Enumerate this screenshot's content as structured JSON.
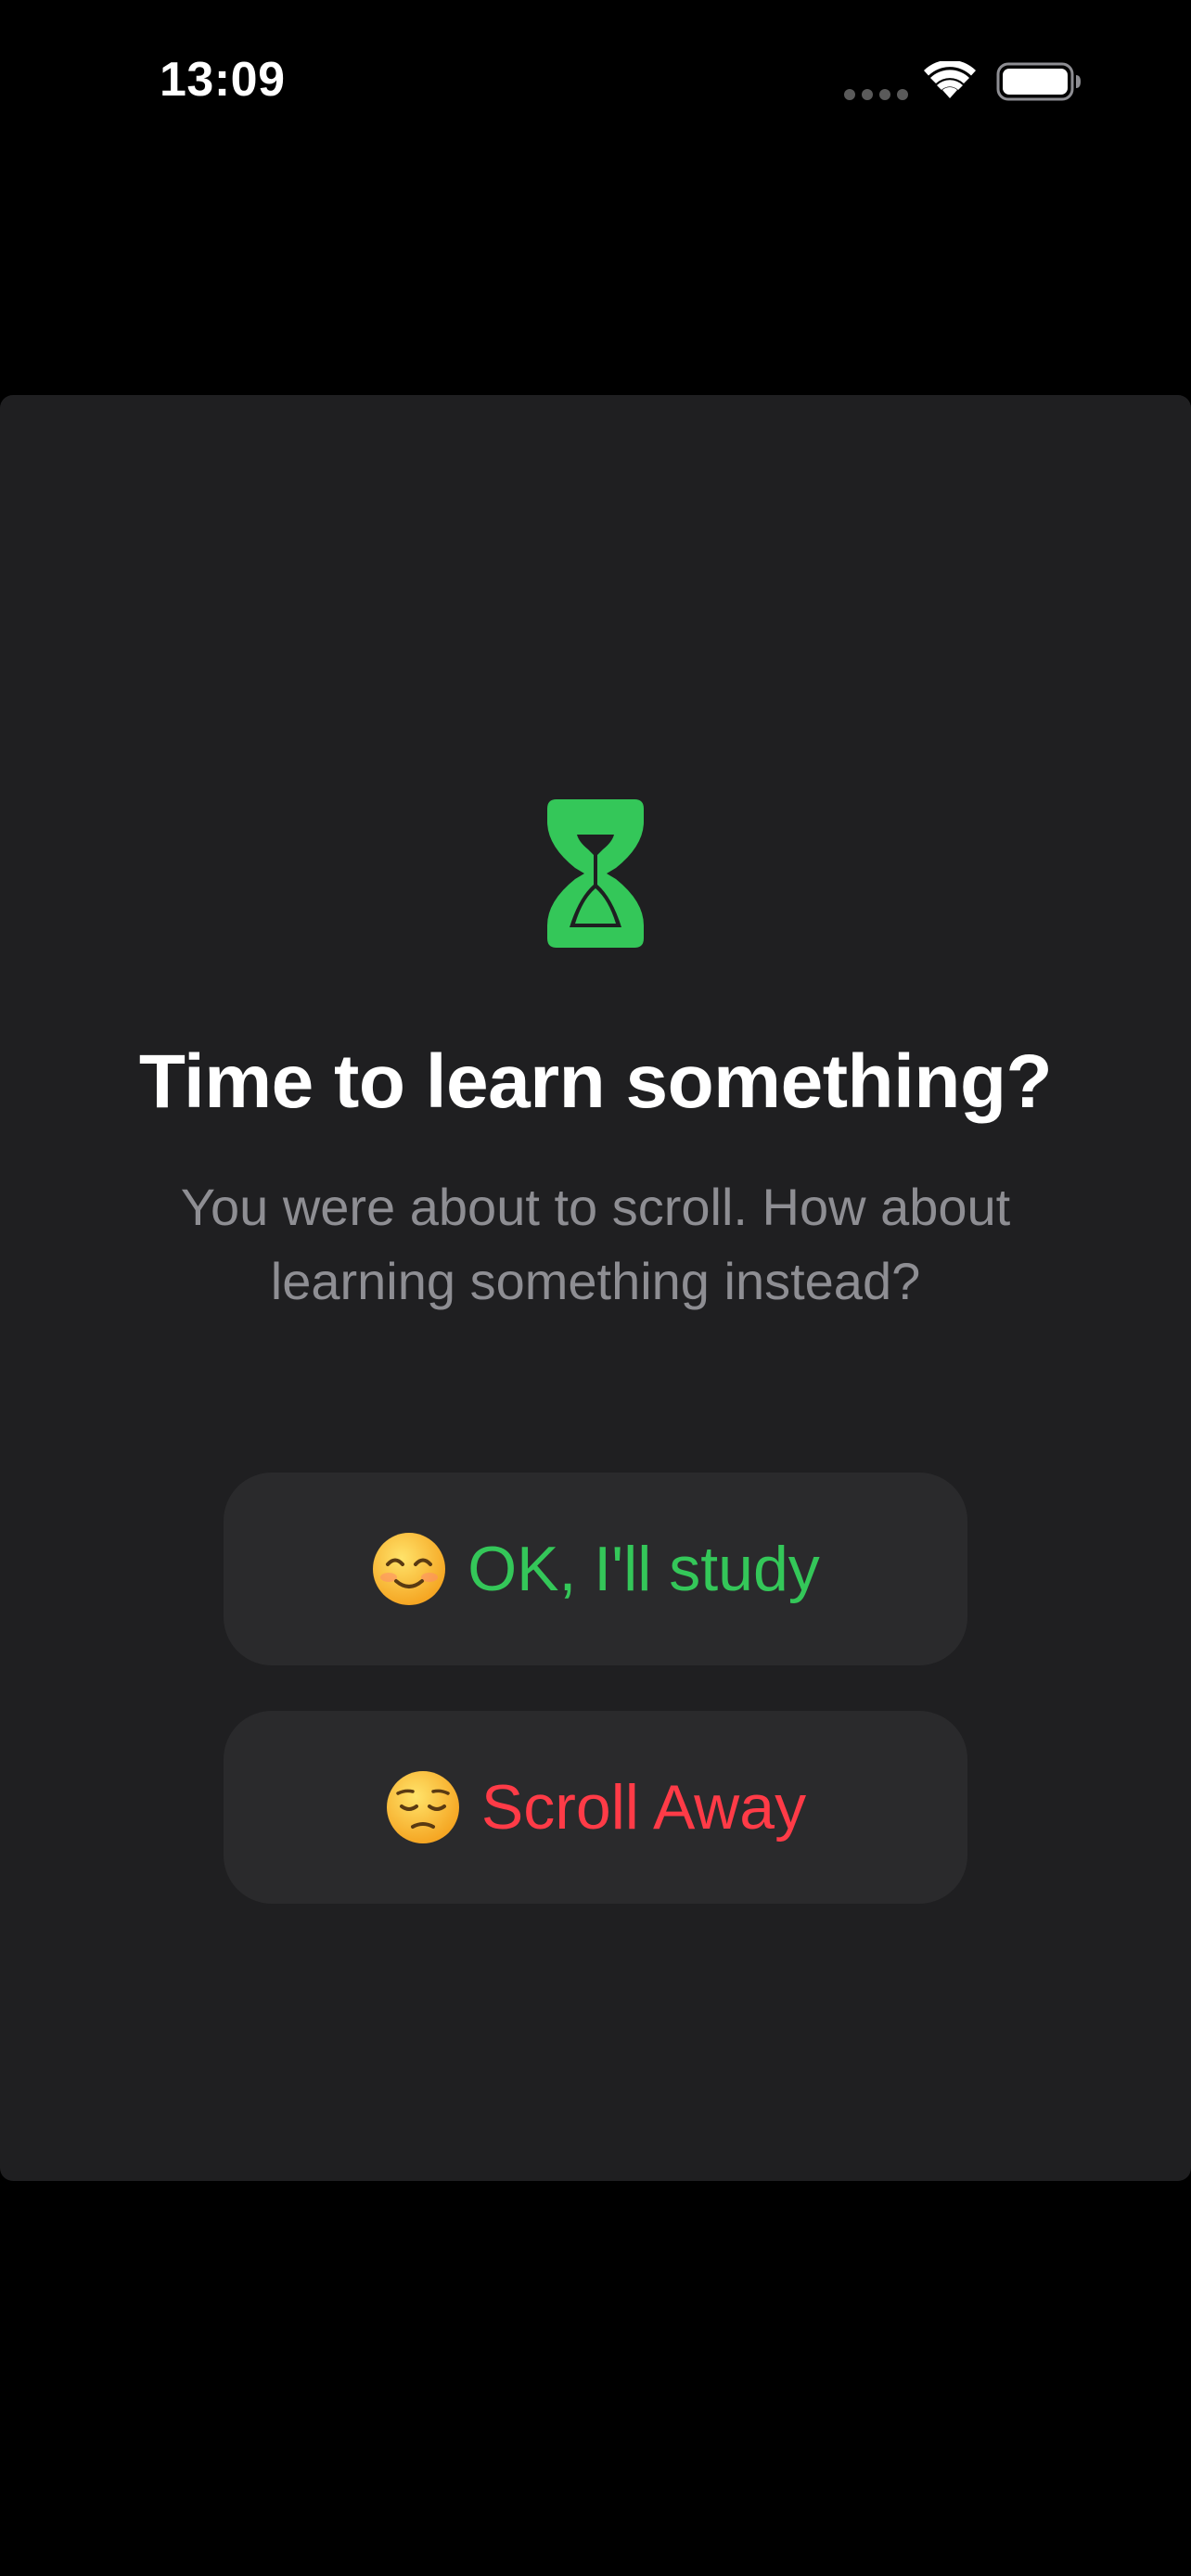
{
  "status_bar": {
    "time": "13:09"
  },
  "prompt": {
    "icon": "hourglass-icon",
    "title": "Time to learn something?",
    "subtitle": "You were about to scroll. How about learning something instead?"
  },
  "actions": {
    "study": {
      "emoji_icon": "smiling-face-icon",
      "label": "OK, I'll study"
    },
    "scroll": {
      "emoji_icon": "pensive-face-icon",
      "label": "Scroll Away"
    }
  },
  "colors": {
    "background": "#000000",
    "card": "#1f1f21",
    "button": "#2a2a2c",
    "accent_green": "#34c759",
    "accent_red": "#ff3b47",
    "secondary_text": "#8e8e93"
  }
}
